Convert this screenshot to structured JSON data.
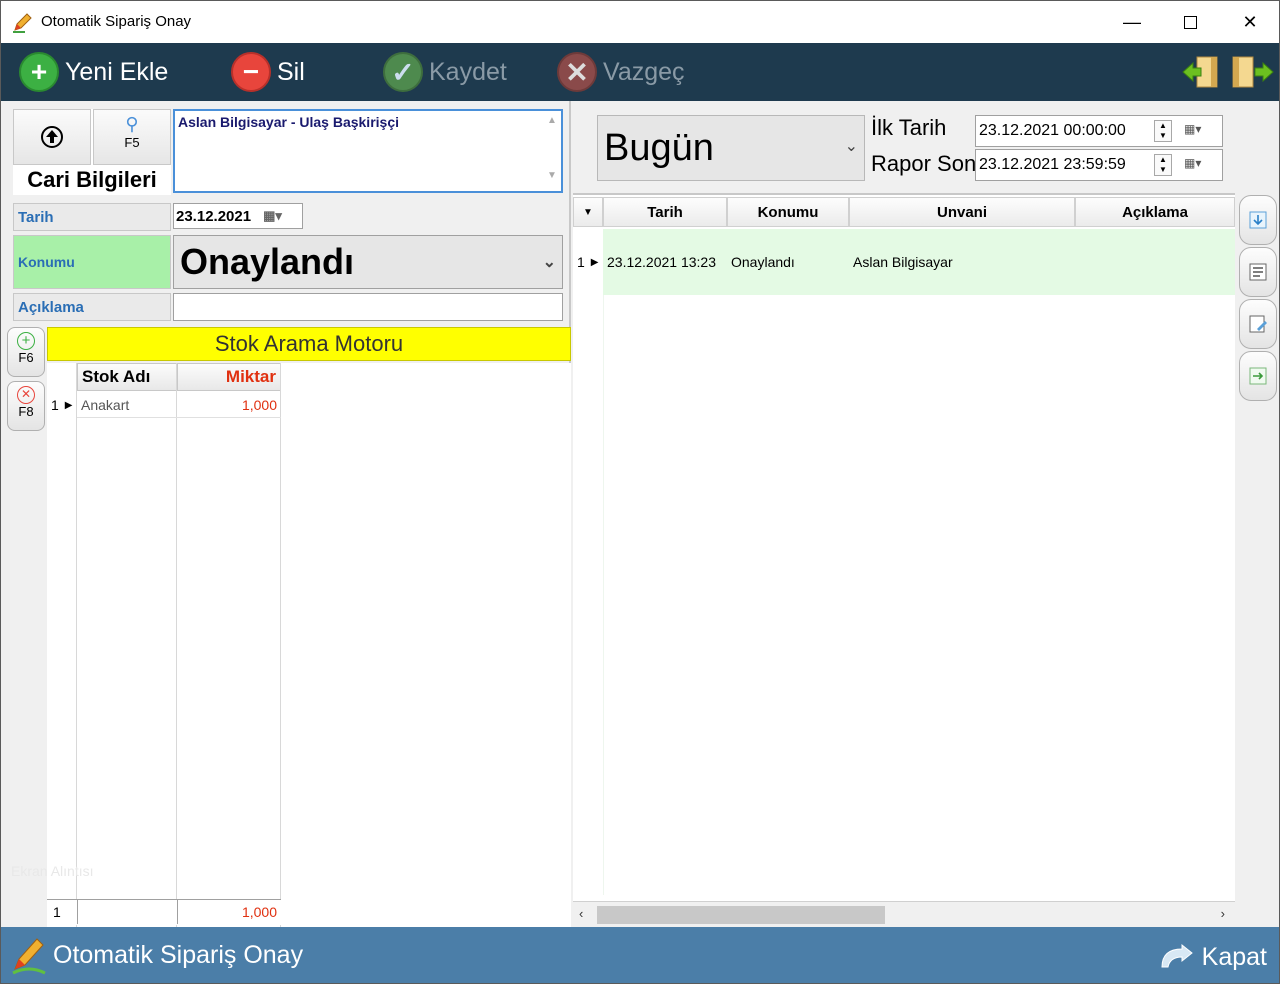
{
  "window": {
    "title": "Otomatik Sipariş Onay"
  },
  "toolbar": {
    "new_label": "Yeni Ekle",
    "delete_label": "Sil",
    "save_label": "Kaydet",
    "cancel_label": "Vazgeç"
  },
  "left": {
    "search_key": "F5",
    "cari_label": "Cari Bilgileri",
    "cari_value": "Aslan Bilgisayar - Ulaş Başkirişçi",
    "tarih_label": "Tarih",
    "tarih_value": "23.12.2021",
    "konumu_label": "Konumu",
    "konumu_value": "Onaylandı",
    "aciklama_label": "Açıklama",
    "aciklama_value": "",
    "add_key": "F6",
    "remove_key": "F8",
    "stok_header": "Stok Arama Motoru",
    "grid": {
      "col_name": "Stok Adı",
      "col_qty": "Miktar",
      "rows": [
        {
          "num": "1",
          "name": "Anakart",
          "qty": "1,000"
        }
      ],
      "footer_count": "1",
      "footer_qty": "1,000"
    },
    "watermark": "Ekran Alıntısı"
  },
  "right": {
    "period": "Bugün",
    "ilk_tarih_label": "İlk Tarih",
    "rapor_son_label": "Rapor Son",
    "ilk_tarih_value": "23.12.2021   00:00:00",
    "rapor_son_value": "23.12.2021   23:59:59",
    "grid": {
      "headers": [
        "Tarih",
        "Konumu",
        "Unvani",
        "Açıklama"
      ],
      "rows": [
        {
          "num": "1",
          "tarih": "23.12.2021 13:23",
          "konumu": "Onaylandı",
          "unvani": "Aslan Bilgisayar",
          "aciklama": ""
        }
      ]
    }
  },
  "footer": {
    "title": "Otomatik Sipariş Onay",
    "close_label": "Kapat"
  },
  "colors": {
    "toolbar_bg": "#1e3a4e",
    "footer_bg": "#4b7ea8",
    "konumu_bg": "#a8f0a8",
    "stok_header_bg": "#ffff00",
    "grid_row_bg": "#e4fae4",
    "qty_color": "#e03010"
  }
}
